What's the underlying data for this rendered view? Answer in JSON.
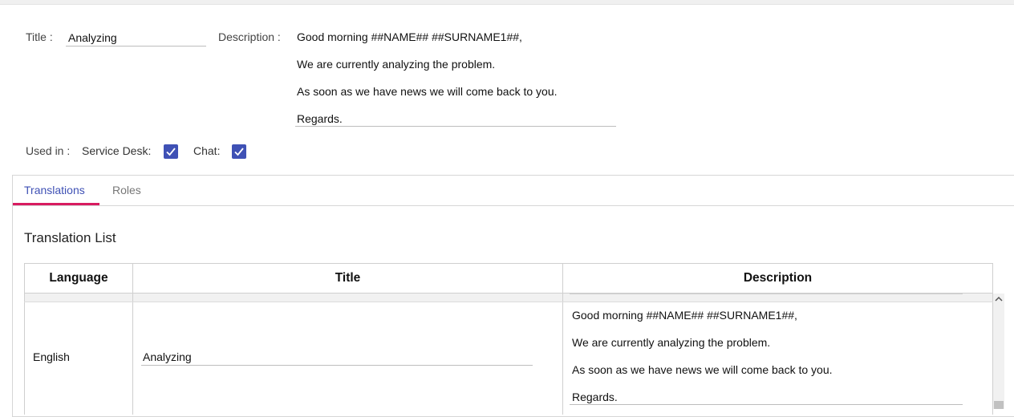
{
  "form": {
    "title_label": "Title :",
    "title_value": "Analyzing",
    "description_label": "Description :",
    "description_lines": [
      "Good morning  ##NAME## ##SURNAME1##,",
      "We are currently analyzing the problem.",
      "As soon as we have news we will come back to you.",
      "Regards."
    ],
    "used_in_label": "Used in :",
    "service_desk_label": "Service Desk:",
    "service_desk_checked": true,
    "chat_label": "Chat:",
    "chat_checked": true
  },
  "tabs": [
    {
      "label": "Translations",
      "active": true
    },
    {
      "label": "Roles",
      "active": false
    }
  ],
  "translation_list": {
    "heading": "Translation List",
    "columns": [
      "Language",
      "Title",
      "Description"
    ],
    "rows": [
      {
        "language": "English",
        "title": "Analyzing",
        "description_lines": [
          "Good morning  ##NAME## ##SURNAME1##,",
          "We are currently analyzing the problem.",
          "As soon as we have news we will come back to you.",
          "Regards."
        ]
      }
    ]
  },
  "colors": {
    "accent": "#3f51b5",
    "tab_indicator": "#d81b60"
  },
  "icons": {
    "checkbox": "check-icon",
    "scroll_up": "chevron-up-icon"
  }
}
